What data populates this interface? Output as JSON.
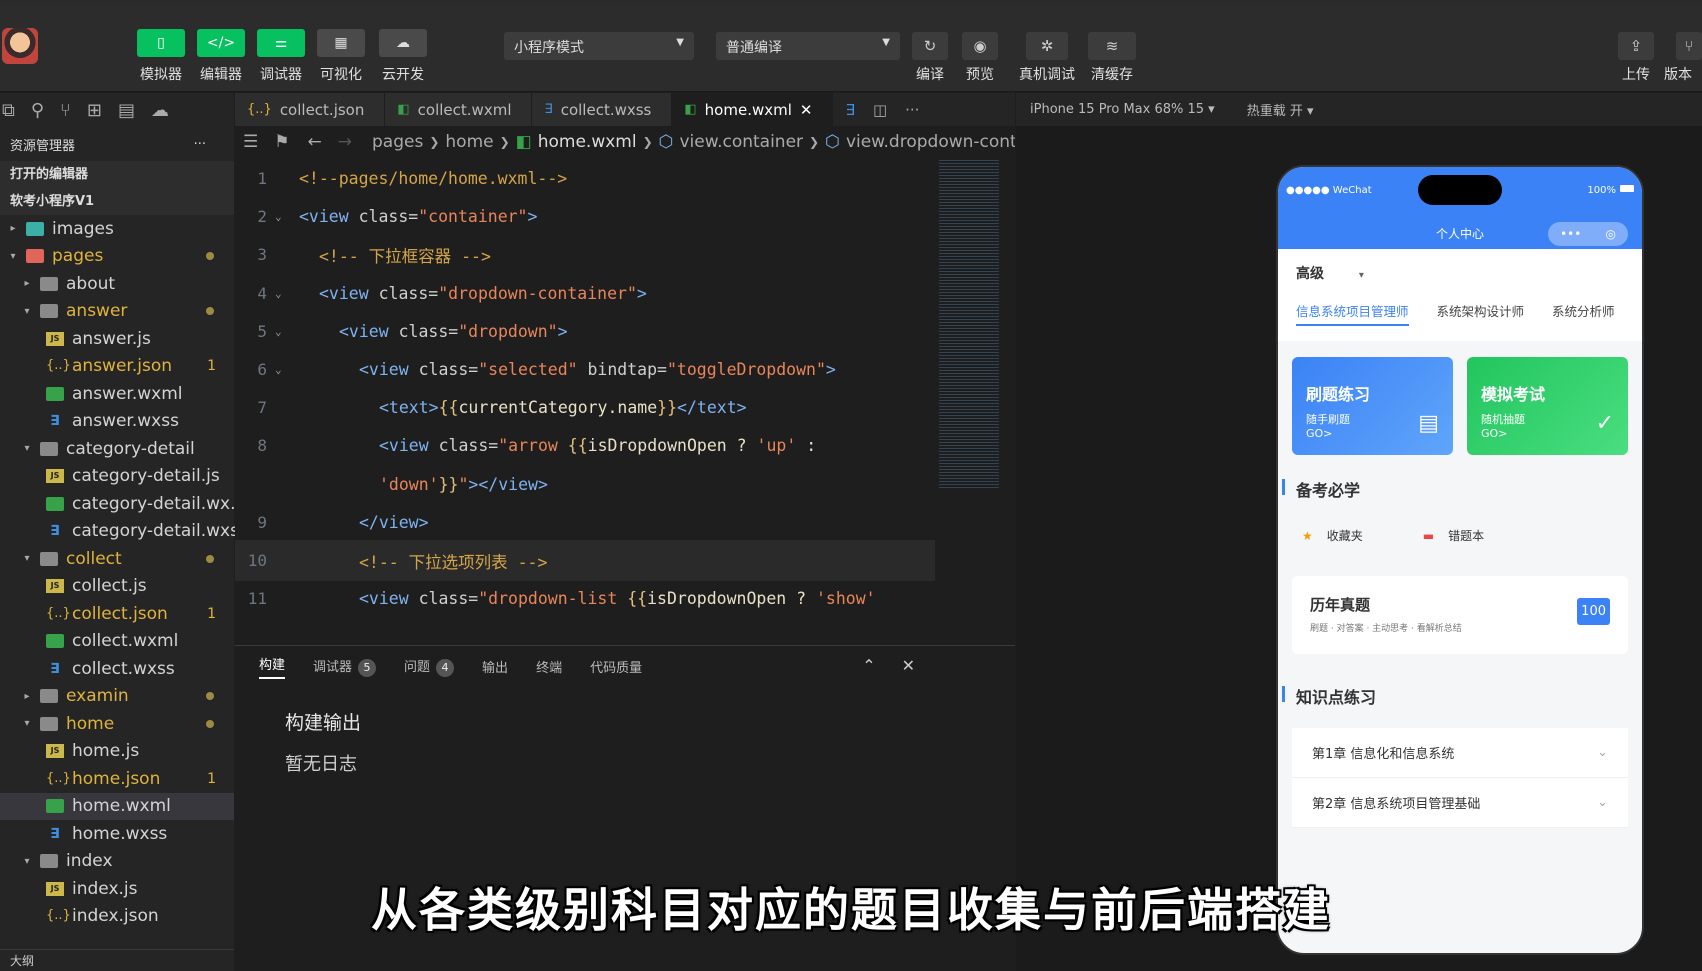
{
  "toolbar": {
    "buttons": [
      {
        "label": "模拟器",
        "glyph": "▯"
      },
      {
        "label": "编辑器",
        "glyph": "</>"
      },
      {
        "label": "调试器",
        "glyph": "⚌"
      },
      {
        "label": "可视化",
        "glyph": "▦"
      },
      {
        "label": "云开发",
        "glyph": "☁"
      }
    ],
    "mode_select": "小程序模式",
    "compile_select": "普通编译",
    "right_buttons": [
      {
        "label": "编译",
        "glyph": "↻"
      },
      {
        "label": "预览",
        "glyph": "◉"
      },
      {
        "label": "真机调试",
        "glyph": "✲"
      },
      {
        "label": "清缓存",
        "glyph": "≋"
      }
    ],
    "far_right": [
      {
        "label": "上传",
        "glyph": "⇪"
      },
      {
        "label": "版本",
        "glyph": "⑂"
      }
    ]
  },
  "sidebar": {
    "title": "资源管理器",
    "more": "···",
    "open_editors": "打开的编辑器",
    "project": "软考小程序V1",
    "outline": "大纲",
    "tree": [
      {
        "label": "images",
        "type": "folder-img",
        "depth": 1,
        "twisty": "▸"
      },
      {
        "label": "pages",
        "type": "folder-red",
        "depth": 1,
        "twisty": "▾",
        "yellow": true,
        "dot": true
      },
      {
        "label": "about",
        "type": "folder",
        "depth": 2,
        "twisty": "▸"
      },
      {
        "label": "answer",
        "type": "folder",
        "depth": 2,
        "twisty": "▾",
        "yellow": true,
        "dot": true
      },
      {
        "label": "answer.js",
        "type": "js",
        "depth": 3
      },
      {
        "label": "answer.json",
        "type": "json",
        "depth": 3,
        "yellow": true,
        "count": "1"
      },
      {
        "label": "answer.wxml",
        "type": "wxml",
        "depth": 3
      },
      {
        "label": "answer.wxss",
        "type": "wxss",
        "depth": 3
      },
      {
        "label": "category-detail",
        "type": "folder",
        "depth": 2,
        "twisty": "▾"
      },
      {
        "label": "category-detail.js",
        "type": "js",
        "depth": 3
      },
      {
        "label": "category-detail.wx...",
        "type": "wxml",
        "depth": 3
      },
      {
        "label": "category-detail.wxss",
        "type": "wxss",
        "depth": 3
      },
      {
        "label": "collect",
        "type": "folder",
        "depth": 2,
        "twisty": "▾",
        "yellow": true,
        "dot": true
      },
      {
        "label": "collect.js",
        "type": "js",
        "depth": 3
      },
      {
        "label": "collect.json",
        "type": "json",
        "depth": 3,
        "yellow": true,
        "count": "1"
      },
      {
        "label": "collect.wxml",
        "type": "wxml",
        "depth": 3
      },
      {
        "label": "collect.wxss",
        "type": "wxss",
        "depth": 3
      },
      {
        "label": "examin",
        "type": "folder",
        "depth": 2,
        "twisty": "▸",
        "yellow": true,
        "dot": true
      },
      {
        "label": "home",
        "type": "folder",
        "depth": 2,
        "twisty": "▾",
        "yellow": true,
        "dot": true
      },
      {
        "label": "home.js",
        "type": "js",
        "depth": 3
      },
      {
        "label": "home.json",
        "type": "json",
        "depth": 3,
        "yellow": true,
        "count": "1"
      },
      {
        "label": "home.wxml",
        "type": "wxml",
        "depth": 3,
        "selected": true
      },
      {
        "label": "home.wxss",
        "type": "wxss",
        "depth": 3
      },
      {
        "label": "index",
        "type": "folder",
        "depth": 2,
        "twisty": "▾"
      },
      {
        "label": "index.js",
        "type": "js",
        "depth": 3
      },
      {
        "label": "index.json",
        "type": "json",
        "depth": 3
      }
    ]
  },
  "tabs": [
    {
      "label": "collect.json",
      "icon": "{..}",
      "color": "#e0b33b"
    },
    {
      "label": "collect.wxml",
      "icon": "◧",
      "color": "#37a24a"
    },
    {
      "label": "collect.wxss",
      "icon": "∃",
      "color": "#3e8fe0"
    },
    {
      "label": "home.wxml",
      "icon": "◧",
      "color": "#37a24a",
      "active": true,
      "close": "✕"
    }
  ],
  "breadcrumb": [
    "pages",
    "home",
    "home.wxml",
    "view.container",
    "view.dropdown-contai"
  ],
  "code": [
    {
      "n": "1",
      "parts": [
        [
          "c-com",
          "<!--pages/home/home.wxml-->"
        ]
      ]
    },
    {
      "n": "2",
      "fold": "v",
      "parts": [
        [
          "c-tag",
          "<view "
        ],
        [
          "c-attr",
          "class="
        ],
        [
          "c-str",
          "\"container\""
        ],
        [
          "c-tag",
          ">"
        ]
      ]
    },
    {
      "n": "3",
      "indent": 1,
      "parts": [
        [
          "c-com",
          "<!-- 下拉框容器 -->"
        ]
      ]
    },
    {
      "n": "4",
      "fold": "v",
      "indent": 1,
      "parts": [
        [
          "c-tag",
          "<view "
        ],
        [
          "c-attr",
          "class="
        ],
        [
          "c-str",
          "\"dropdown-container\""
        ],
        [
          "c-tag",
          ">"
        ]
      ]
    },
    {
      "n": "5",
      "fold": "v",
      "indent": 2,
      "parts": [
        [
          "c-tag",
          "<view "
        ],
        [
          "c-attr",
          "class="
        ],
        [
          "c-str",
          "\"dropdown\""
        ],
        [
          "c-tag",
          ">"
        ]
      ]
    },
    {
      "n": "6",
      "fold": "v",
      "indent": 3,
      "parts": [
        [
          "c-tag",
          "<view "
        ],
        [
          "c-attr",
          "class="
        ],
        [
          "c-str",
          "\"selected\""
        ],
        [
          "c-attr",
          " bindtap="
        ],
        [
          "c-str",
          "\"toggleDropdown\""
        ],
        [
          "c-tag",
          ">"
        ]
      ]
    },
    {
      "n": "7",
      "indent": 4,
      "parts": [
        [
          "c-tag",
          "<text>"
        ],
        [
          "c-brace",
          "{{"
        ],
        [
          "c-exp",
          "currentCategory.name"
        ],
        [
          "c-brace",
          "}}"
        ],
        [
          "c-tag",
          "</text>"
        ]
      ]
    },
    {
      "n": "8",
      "indent": 4,
      "parts": [
        [
          "c-tag",
          "<view "
        ],
        [
          "c-attr",
          "class="
        ],
        [
          "c-str",
          "\"arrow "
        ],
        [
          "c-brace",
          "{{"
        ],
        [
          "c-exp",
          "isDropdownOpen ? "
        ],
        [
          "c-str",
          "'up'"
        ],
        [
          "c-exp",
          " :"
        ]
      ]
    },
    {
      "n": "",
      "indent": 4,
      "parts": [
        [
          "c-str",
          "'down'"
        ],
        [
          "c-brace",
          "}}"
        ],
        [
          "c-str",
          "\""
        ],
        [
          "c-tag",
          "></view>"
        ]
      ]
    },
    {
      "n": "9",
      "indent": 3,
      "parts": [
        [
          "c-tag",
          "</view>"
        ]
      ]
    },
    {
      "n": "10",
      "indent": 3,
      "hl": true,
      "parts": [
        [
          "c-com",
          "<!-- 下拉选项列表 -->"
        ]
      ]
    },
    {
      "n": "11",
      "indent": 3,
      "parts": [
        [
          "c-tag",
          "<view "
        ],
        [
          "c-attr",
          "class="
        ],
        [
          "c-str",
          "\"dropdown-list "
        ],
        [
          "c-brace",
          "{{"
        ],
        [
          "c-exp",
          "isDropdownOpen ? "
        ],
        [
          "c-str",
          "'show'"
        ]
      ]
    }
  ],
  "panel": {
    "tabs": [
      {
        "label": "构建",
        "active": true
      },
      {
        "label": "调试器",
        "badge": "5"
      },
      {
        "label": "问题",
        "badge": "4"
      },
      {
        "label": "输出"
      },
      {
        "label": "终端"
      },
      {
        "label": "代码质量"
      }
    ],
    "title": "构建输出",
    "empty": "暂无日志"
  },
  "simulator": {
    "device": "iPhone 15 Pro Max 68% 15 ▾",
    "hot_reload": "热重载 开 ▾",
    "status_left": "●●●●● WeChat",
    "status_right": "100%",
    "nav_title": "个人中心",
    "capsule_dots": "•••",
    "capsule_circle": "◎",
    "level": "高级",
    "level_caret": "▾",
    "category_tabs": [
      "信息系统项目管理师",
      "系统架构设计师",
      "系统分析师"
    ],
    "cards": [
      {
        "title": "刷题练习",
        "sub": "随手刷题",
        "go": "GO>",
        "icon": "▤"
      },
      {
        "title": "模拟考试",
        "sub": "随机抽题",
        "go": "GO>",
        "icon": "✓"
      }
    ],
    "section_prep": "备考必学",
    "quick": [
      {
        "label": "收藏夹",
        "icon": "★"
      },
      {
        "label": "错题本",
        "icon": "▬"
      }
    ],
    "past": {
      "title": "历年真题",
      "sub": "刷题 · 对答案 · 主动思考 · 看解析总结",
      "badge": "100"
    },
    "section_knowledge": "知识点练习",
    "chapters": [
      {
        "label": "第1章 信息化和信息系统",
        "chevron": "⌄"
      },
      {
        "label": "第2章 信息系统项目管理基础",
        "chevron": "⌄"
      }
    ]
  },
  "subtitle": "从各类级别科目对应的题目收集与前后端搭建"
}
